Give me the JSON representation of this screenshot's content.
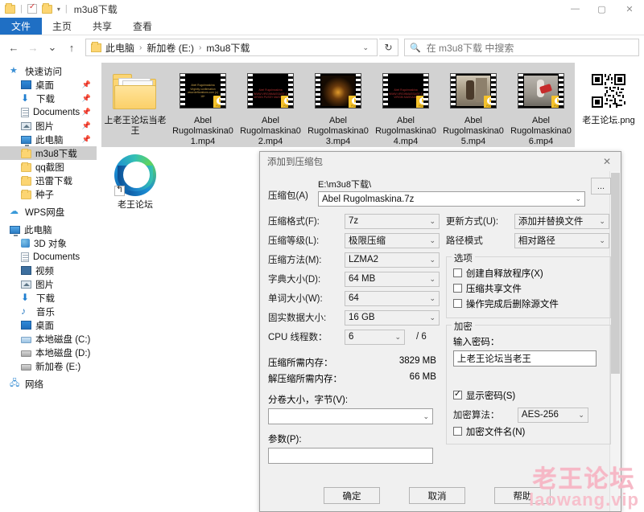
{
  "window": {
    "title": "m3u8下载",
    "controls": {
      "minimize": "—",
      "maximize": "▢",
      "close": "✕"
    },
    "quick_access_caret": "▾",
    "separator": "|"
  },
  "ribbon": {
    "tabs": [
      {
        "label": "文件",
        "active": true
      },
      {
        "label": "主页",
        "active": false
      },
      {
        "label": "共享",
        "active": false
      },
      {
        "label": "查看",
        "active": false
      }
    ]
  },
  "navbar": {
    "back": "←",
    "forward": "→",
    "recent": "⌄",
    "up": "↑",
    "breadcrumbs": [
      "此电脑",
      "新加卷 (E:)",
      "m3u8下载"
    ],
    "crumb_separator": "›",
    "address_caret": "⌄",
    "refresh": "↻",
    "search": {
      "icon": "search-icon",
      "placeholder": "在 m3u8下载 中搜索",
      "value": ""
    }
  },
  "sidebar": {
    "items": [
      {
        "label": "快速访问",
        "icon": "star-icon",
        "level": 0,
        "pinned": false,
        "selected": false
      },
      {
        "label": "桌面",
        "icon": "desktop-icon",
        "level": 1,
        "pinned": true,
        "selected": false
      },
      {
        "label": "下载",
        "icon": "download-icon",
        "level": 1,
        "pinned": true,
        "selected": false
      },
      {
        "label": "Documents",
        "icon": "document-icon",
        "level": 1,
        "pinned": true,
        "selected": false
      },
      {
        "label": "图片",
        "icon": "pictures-icon",
        "level": 1,
        "pinned": true,
        "selected": false
      },
      {
        "label": "此电脑",
        "icon": "pc-icon",
        "level": 1,
        "pinned": true,
        "selected": false
      },
      {
        "label": "m3u8下载",
        "icon": "folder-icon",
        "level": 2,
        "pinned": false,
        "selected": true
      },
      {
        "label": "qq截图",
        "icon": "folder-icon",
        "level": 2,
        "pinned": false,
        "selected": false
      },
      {
        "label": "迅雷下载",
        "icon": "folder-icon",
        "level": 2,
        "pinned": false,
        "selected": false
      },
      {
        "label": "种子",
        "icon": "folder-icon",
        "level": 2,
        "pinned": false,
        "selected": false
      },
      {
        "label": "WPS网盘",
        "icon": "cloud-icon",
        "level": 0,
        "pinned": false,
        "selected": false
      },
      {
        "label": "此电脑",
        "icon": "pc-icon",
        "level": 0,
        "pinned": false,
        "selected": false
      },
      {
        "label": "3D 对象",
        "icon": "3d-object-icon",
        "level": 1,
        "pinned": false,
        "selected": false
      },
      {
        "label": "Documents",
        "icon": "document-icon",
        "level": 1,
        "pinned": false,
        "selected": false
      },
      {
        "label": "视频",
        "icon": "video-icon",
        "level": 1,
        "pinned": false,
        "selected": false
      },
      {
        "label": "图片",
        "icon": "pictures-icon",
        "level": 1,
        "pinned": false,
        "selected": false
      },
      {
        "label": "下载",
        "icon": "download-icon",
        "level": 1,
        "pinned": false,
        "selected": false
      },
      {
        "label": "音乐",
        "icon": "music-icon",
        "level": 1,
        "pinned": false,
        "selected": false
      },
      {
        "label": "桌面",
        "icon": "desktop-icon",
        "level": 1,
        "pinned": false,
        "selected": false
      },
      {
        "label": "本地磁盘 (C:)",
        "icon": "system-drive-icon",
        "level": 1,
        "pinned": false,
        "selected": false
      },
      {
        "label": "本地磁盘 (D:)",
        "icon": "drive-icon",
        "level": 1,
        "pinned": false,
        "selected": false
      },
      {
        "label": "新加卷 (E:)",
        "icon": "drive-icon",
        "level": 1,
        "pinned": false,
        "selected": false
      },
      {
        "label": "网络",
        "icon": "network-icon",
        "level": 0,
        "pinned": false,
        "selected": false
      }
    ]
  },
  "files": [
    {
      "name": "上老王论坛当老王",
      "type": "folder",
      "selected": true,
      "badge": ""
    },
    {
      "name": "Abel Rugolmaskina01.mp4",
      "type": "video",
      "selected": true,
      "badge": "Player",
      "preview_text": "Abel Rugolmaskina\nVirginity confirmation\nwww.deflorations.com (c)\n18+"
    },
    {
      "name": "Abel Rugolmaskina02.mp4",
      "type": "video",
      "selected": true,
      "badge": "Player",
      "preview_text": "Abel Rugolmaskina\nWWW.VIRGINMASSAGE.COM\nVIRGIN PUSSY MASSAGE"
    },
    {
      "name": "Abel Rugolmaskina03.mp4",
      "type": "video",
      "selected": true,
      "badge": "Player",
      "preview_text": ""
    },
    {
      "name": "Abel Rugolmaskina04.mp4",
      "type": "video",
      "selected": true,
      "badge": "Player",
      "preview_text": "Abel Rugolmaskina\nWWW.VIRGINMASSAGE.COM\nVIRGIN MASSAGE"
    },
    {
      "name": "Abel Rugolmaskina05.mp4",
      "type": "video",
      "selected": true,
      "badge": "Player",
      "preview_text": ""
    },
    {
      "name": "Abel Rugolmaskina06.mp4",
      "type": "video",
      "selected": true,
      "badge": "Player",
      "preview_text": ""
    },
    {
      "name": "老王论坛.png",
      "type": "image-qr",
      "selected": false,
      "badge": ""
    },
    {
      "name": "老王论坛",
      "type": "edge-shortcut",
      "selected": false,
      "badge": ""
    }
  ],
  "dialog": {
    "title": "添加到压缩包",
    "close": "✕",
    "archive": {
      "label": "压缩包(A)",
      "path": "E:\\m3u8下载\\",
      "value": "Abel Rugolmaskina.7z",
      "browse_label": "..."
    },
    "left_fields": [
      {
        "label": "压缩格式(F):",
        "value": "7z"
      },
      {
        "label": "压缩等级(L):",
        "value": "极限压缩"
      },
      {
        "label": "压缩方法(M):",
        "value": "LZMA2"
      },
      {
        "label": "字典大小(D):",
        "value": "64 MB"
      },
      {
        "label": "单词大小(W):",
        "value": "64"
      },
      {
        "label": "固实数据大小:",
        "value": "16 GB"
      }
    ],
    "cpu": {
      "label": "CPU 线程数：",
      "value": "6",
      "total": "/ 6"
    },
    "memory": [
      {
        "label": "压缩所需内存：",
        "value": "3829 MB"
      },
      {
        "label": "解压缩所需内存：",
        "value": "66 MB"
      }
    ],
    "volume": {
      "label": "分卷大小，字节(V):",
      "value": ""
    },
    "parameters": {
      "label": "参数(P):",
      "value": ""
    },
    "right_fields": [
      {
        "label": "更新方式(U):",
        "value": "添加并替换文件"
      },
      {
        "label": "路径模式",
        "value": "相对路径"
      }
    ],
    "options": {
      "title": "选项",
      "items": [
        {
          "label": "创建自释放程序(X)",
          "checked": false
        },
        {
          "label": "压缩共享文件",
          "checked": false
        },
        {
          "label": "操作完成后删除源文件",
          "checked": false
        }
      ]
    },
    "encryption": {
      "title": "加密",
      "password_label": "输入密码：",
      "password_value": "上老王论坛当老王",
      "show_password": {
        "label": "显示密码(S)",
        "checked": true
      },
      "algorithm_label": "加密算法：",
      "algorithm_value": "AES-256",
      "encrypt_names": {
        "label": "加密文件名(N)",
        "checked": false
      }
    },
    "buttons": [
      {
        "label": "确定",
        "name": "ok"
      },
      {
        "label": "取消",
        "name": "cancel"
      },
      {
        "label": "帮助",
        "name": "help"
      }
    ]
  },
  "watermark": {
    "line1": "老王论坛",
    "line2": "laowang.vip",
    "color": "#f6b8c6"
  }
}
